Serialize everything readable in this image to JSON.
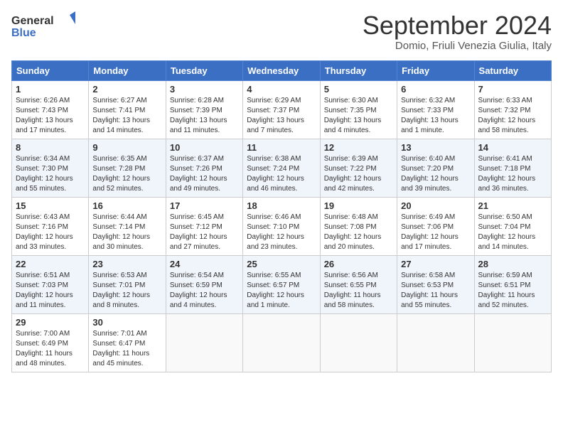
{
  "header": {
    "logo_line1": "General",
    "logo_line2": "Blue",
    "month_title": "September 2024",
    "subtitle": "Domio, Friuli Venezia Giulia, Italy"
  },
  "days_of_week": [
    "Sunday",
    "Monday",
    "Tuesday",
    "Wednesday",
    "Thursday",
    "Friday",
    "Saturday"
  ],
  "weeks": [
    [
      {
        "day": "1",
        "info": "Sunrise: 6:26 AM\nSunset: 7:43 PM\nDaylight: 13 hours\nand 17 minutes."
      },
      {
        "day": "2",
        "info": "Sunrise: 6:27 AM\nSunset: 7:41 PM\nDaylight: 13 hours\nand 14 minutes."
      },
      {
        "day": "3",
        "info": "Sunrise: 6:28 AM\nSunset: 7:39 PM\nDaylight: 13 hours\nand 11 minutes."
      },
      {
        "day": "4",
        "info": "Sunrise: 6:29 AM\nSunset: 7:37 PM\nDaylight: 13 hours\nand 7 minutes."
      },
      {
        "day": "5",
        "info": "Sunrise: 6:30 AM\nSunset: 7:35 PM\nDaylight: 13 hours\nand 4 minutes."
      },
      {
        "day": "6",
        "info": "Sunrise: 6:32 AM\nSunset: 7:33 PM\nDaylight: 13 hours\nand 1 minute."
      },
      {
        "day": "7",
        "info": "Sunrise: 6:33 AM\nSunset: 7:32 PM\nDaylight: 12 hours\nand 58 minutes."
      }
    ],
    [
      {
        "day": "8",
        "info": "Sunrise: 6:34 AM\nSunset: 7:30 PM\nDaylight: 12 hours\nand 55 minutes."
      },
      {
        "day": "9",
        "info": "Sunrise: 6:35 AM\nSunset: 7:28 PM\nDaylight: 12 hours\nand 52 minutes."
      },
      {
        "day": "10",
        "info": "Sunrise: 6:37 AM\nSunset: 7:26 PM\nDaylight: 12 hours\nand 49 minutes."
      },
      {
        "day": "11",
        "info": "Sunrise: 6:38 AM\nSunset: 7:24 PM\nDaylight: 12 hours\nand 46 minutes."
      },
      {
        "day": "12",
        "info": "Sunrise: 6:39 AM\nSunset: 7:22 PM\nDaylight: 12 hours\nand 42 minutes."
      },
      {
        "day": "13",
        "info": "Sunrise: 6:40 AM\nSunset: 7:20 PM\nDaylight: 12 hours\nand 39 minutes."
      },
      {
        "day": "14",
        "info": "Sunrise: 6:41 AM\nSunset: 7:18 PM\nDaylight: 12 hours\nand 36 minutes."
      }
    ],
    [
      {
        "day": "15",
        "info": "Sunrise: 6:43 AM\nSunset: 7:16 PM\nDaylight: 12 hours\nand 33 minutes."
      },
      {
        "day": "16",
        "info": "Sunrise: 6:44 AM\nSunset: 7:14 PM\nDaylight: 12 hours\nand 30 minutes."
      },
      {
        "day": "17",
        "info": "Sunrise: 6:45 AM\nSunset: 7:12 PM\nDaylight: 12 hours\nand 27 minutes."
      },
      {
        "day": "18",
        "info": "Sunrise: 6:46 AM\nSunset: 7:10 PM\nDaylight: 12 hours\nand 23 minutes."
      },
      {
        "day": "19",
        "info": "Sunrise: 6:48 AM\nSunset: 7:08 PM\nDaylight: 12 hours\nand 20 minutes."
      },
      {
        "day": "20",
        "info": "Sunrise: 6:49 AM\nSunset: 7:06 PM\nDaylight: 12 hours\nand 17 minutes."
      },
      {
        "day": "21",
        "info": "Sunrise: 6:50 AM\nSunset: 7:04 PM\nDaylight: 12 hours\nand 14 minutes."
      }
    ],
    [
      {
        "day": "22",
        "info": "Sunrise: 6:51 AM\nSunset: 7:03 PM\nDaylight: 12 hours\nand 11 minutes."
      },
      {
        "day": "23",
        "info": "Sunrise: 6:53 AM\nSunset: 7:01 PM\nDaylight: 12 hours\nand 8 minutes."
      },
      {
        "day": "24",
        "info": "Sunrise: 6:54 AM\nSunset: 6:59 PM\nDaylight: 12 hours\nand 4 minutes."
      },
      {
        "day": "25",
        "info": "Sunrise: 6:55 AM\nSunset: 6:57 PM\nDaylight: 12 hours\nand 1 minute."
      },
      {
        "day": "26",
        "info": "Sunrise: 6:56 AM\nSunset: 6:55 PM\nDaylight: 11 hours\nand 58 minutes."
      },
      {
        "day": "27",
        "info": "Sunrise: 6:58 AM\nSunset: 6:53 PM\nDaylight: 11 hours\nand 55 minutes."
      },
      {
        "day": "28",
        "info": "Sunrise: 6:59 AM\nSunset: 6:51 PM\nDaylight: 11 hours\nand 52 minutes."
      }
    ],
    [
      {
        "day": "29",
        "info": "Sunrise: 7:00 AM\nSunset: 6:49 PM\nDaylight: 11 hours\nand 48 minutes."
      },
      {
        "day": "30",
        "info": "Sunrise: 7:01 AM\nSunset: 6:47 PM\nDaylight: 11 hours\nand 45 minutes."
      },
      {
        "day": "",
        "info": ""
      },
      {
        "day": "",
        "info": ""
      },
      {
        "day": "",
        "info": ""
      },
      {
        "day": "",
        "info": ""
      },
      {
        "day": "",
        "info": ""
      }
    ]
  ]
}
